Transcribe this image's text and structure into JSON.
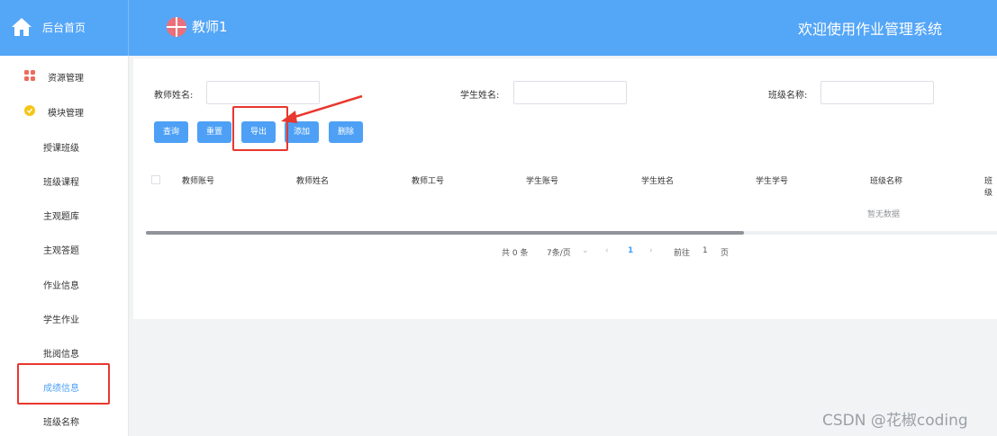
{
  "header": {
    "home_label": "后台首页",
    "user_name": "教师1",
    "welcome": "欢迎使用作业管理系统"
  },
  "sidebar": {
    "groups": [
      {
        "label": "资源管理",
        "icon": "grid-icon"
      },
      {
        "label": "模块管理",
        "icon": "shield-icon"
      }
    ],
    "items": [
      {
        "label": "授课班级"
      },
      {
        "label": "班级课程"
      },
      {
        "label": "主观题库"
      },
      {
        "label": "主观答题"
      },
      {
        "label": "作业信息"
      },
      {
        "label": "学生作业"
      },
      {
        "label": "批阅信息"
      },
      {
        "label": "成绩信息",
        "active": true
      },
      {
        "label": "班级名称"
      }
    ]
  },
  "filters": {
    "teacher_name_label": "教师姓名:",
    "student_name_label": "学生姓名:",
    "class_name_label": "班级名称:"
  },
  "buttons": {
    "query": "查询",
    "reset": "重置",
    "export": "导出",
    "add": "添加",
    "delete": "删除"
  },
  "table": {
    "columns": [
      "教师账号",
      "教师姓名",
      "教师工号",
      "学生账号",
      "学生姓名",
      "学生学号",
      "班级名称",
      "班级"
    ],
    "empty_text": "暂无数据"
  },
  "pagination": {
    "total": "共 0 条",
    "page_size": "7条/页",
    "current_page": "1",
    "goto_label": "前往",
    "goto_value": "1",
    "page_unit": "页"
  },
  "watermark": "CSDN @花椒coding",
  "colors": {
    "primary": "#4da0f5",
    "header": "#54a6f7",
    "annotation_red": "#e8372e"
  }
}
